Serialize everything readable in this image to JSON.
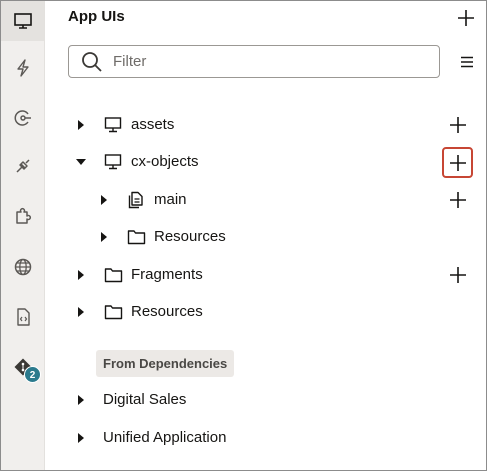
{
  "rail": {
    "items": [
      {
        "icon": "monitor-icon",
        "active": true
      },
      {
        "icon": "lightning-icon"
      },
      {
        "icon": "process-icon"
      },
      {
        "icon": "plug-icon"
      },
      {
        "icon": "puzzle-icon"
      },
      {
        "icon": "globe-icon"
      },
      {
        "icon": "code-file-icon"
      },
      {
        "icon": "git-icon",
        "badge": "2"
      }
    ]
  },
  "panel": {
    "title": "App UIs",
    "filter_placeholder": "Filter"
  },
  "tree": {
    "assets": "assets",
    "cx_objects": "cx-objects",
    "main": "main",
    "resources_child": "Resources",
    "fragments": "Fragments",
    "resources": "Resources"
  },
  "dependencies": {
    "heading": "From Dependencies",
    "items": [
      "Digital Sales",
      "Unified Application"
    ]
  },
  "colors": {
    "highlight": "#c74634",
    "badge": "#2b7a8d"
  }
}
